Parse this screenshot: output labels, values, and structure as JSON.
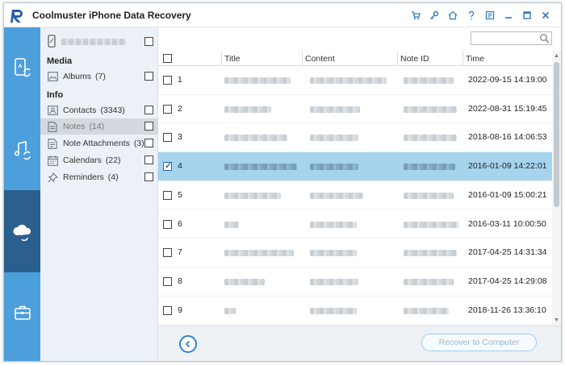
{
  "app": {
    "title": "Coolmuster iPhone Data Recovery"
  },
  "titlebar_icons": [
    "cart-icon",
    "key-icon",
    "home-icon",
    "help-icon",
    "feedback-icon",
    "minimize-icon",
    "maximize-icon",
    "close-icon"
  ],
  "rail": [
    "phone-sync-icon",
    "music-sync-icon",
    "cloud-sync-icon",
    "toolbox-icon"
  ],
  "sidebar": {
    "media_label": "Media",
    "info_label": "Info",
    "media": [
      {
        "label": "Albums",
        "count": "(7)",
        "icon": "image-icon"
      }
    ],
    "info": [
      {
        "label": "Contacts",
        "count": "(3343)",
        "icon": "contact-icon"
      },
      {
        "label": "Notes",
        "count": "(14)",
        "icon": "note-icon"
      },
      {
        "label": "Note Attachments",
        "count": "(3)",
        "icon": "attachment-icon"
      },
      {
        "label": "Calendars",
        "count": "(22)",
        "icon": "calendar-icon"
      },
      {
        "label": "Reminders",
        "count": "(4)",
        "icon": "pin-icon"
      }
    ]
  },
  "table": {
    "headers": {
      "title": "Title",
      "content": "Content",
      "note_id": "Note ID",
      "time": "Time"
    },
    "rows": [
      {
        "num": "1",
        "time": "2022-09-15 14:19:00",
        "selected": false
      },
      {
        "num": "2",
        "time": "2022-08-31 15:19:45",
        "selected": false
      },
      {
        "num": "3",
        "time": "2018-08-16 14:06:53",
        "selected": false
      },
      {
        "num": "4",
        "time": "2016-01-09 14:22:01",
        "selected": true
      },
      {
        "num": "5",
        "time": "2016-01-09 15:00:21",
        "selected": false
      },
      {
        "num": "6",
        "time": "2016-03-11 10:00:50",
        "selected": false
      },
      {
        "num": "7",
        "time": "2017-04-25 14:31:34",
        "selected": false
      },
      {
        "num": "8",
        "time": "2017-04-25 14:29:08",
        "selected": false
      },
      {
        "num": "9",
        "time": "2018-11-26 13:36:10",
        "selected": false
      }
    ]
  },
  "footer": {
    "recover_label": "Recover to Computer"
  },
  "colors": {
    "accent": "#4d9fdc",
    "rail_active": "#2b5f8e",
    "selected_row": "#a6d3ee"
  }
}
